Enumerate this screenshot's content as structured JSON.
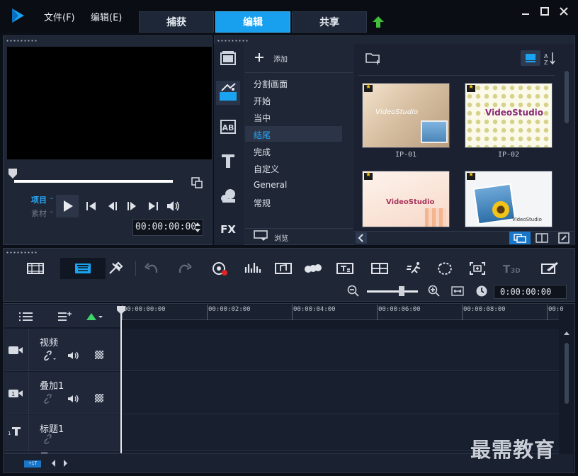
{
  "menu": {
    "file": "文件(F)",
    "edit": "编辑(E)"
  },
  "tabs": {
    "capture": "捕获",
    "edit": "编辑",
    "share": "共享"
  },
  "preview": {
    "mode_project": "项目",
    "mode_clip": "素材",
    "timecode": "00:00:00:00",
    "progress": 0
  },
  "library": {
    "add_label": "添加",
    "browse_label": "浏览",
    "categories": [
      "分割画面",
      "开始",
      "当中",
      "结尾",
      "完成",
      "自定义",
      "General",
      "常规"
    ],
    "selected_category": "结尾",
    "thumbnails": [
      {
        "label": "IP-01",
        "text": "VideoStudio"
      },
      {
        "label": "IP-02",
        "text": "VideoStudio"
      },
      {
        "label": "",
        "text": "VideoStudio"
      },
      {
        "label": "",
        "text": "VideoStudio"
      }
    ]
  },
  "timeline": {
    "zoom_timecode": "0:00:00:00",
    "ruler": [
      "00:00:00:00",
      "00:00:02:00",
      "00:00:04:00",
      "00:00:06:00",
      "00:00:08:00",
      "00:0"
    ],
    "tracks": [
      {
        "name": "视频"
      },
      {
        "name": "叠加1"
      },
      {
        "name": "标题1"
      },
      {
        "name": "声"
      }
    ]
  },
  "watermark": "最需教育",
  "colors": {
    "accent": "#18a0ee",
    "panel": "#1f2635",
    "background": "#0b0f17"
  }
}
